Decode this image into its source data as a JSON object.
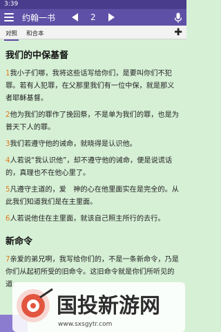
{
  "status": {
    "time": "3:39"
  },
  "header": {
    "title": "约翰一书",
    "chapter": "2"
  },
  "tabs": [
    "对照",
    "和合本"
  ],
  "content": {
    "heading1": "我们的中保基督",
    "verses1": [
      {
        "num": "1",
        "text": "我小子们哪，我将这些话写给你们，是要叫你们不犯罪。若有人犯罪，在父那里我们有一位中保，就是那义者耶稣基督。"
      },
      {
        "num": "2",
        "text": "他为我们的罪作了挽回祭，不是单为我们的罪，也是为普天下人的罪。"
      },
      {
        "num": "3",
        "text": "我们若遵守他的诫命，就晓得是认识他。"
      },
      {
        "num": "4",
        "text": "人若说“我认识他”，却不遵守他的诫命，便是说谎话的，真理也不在他心里了。"
      },
      {
        "num": "5",
        "text": "凡遵守主道的，爱　神的心在他里面实在是完全的。从此我们知道我们是在主里面。"
      },
      {
        "num": "6",
        "text": "人若说他住在主里面，就该自己照主所行的去行。"
      }
    ],
    "heading2": "新命令",
    "verses2": [
      {
        "num": "7",
        "text": "亲爱的弟兄啊，我写给你们的，不是一条新命令，乃是你们从起初所受的旧命令。这旧命令就是你们所听见的道。"
      }
    ]
  },
  "watermark": {
    "text": "国投新游网",
    "url": "www.sxsgytr.com"
  },
  "colors": {
    "appbar": "#5e50a6",
    "statusbar": "#4a3c8c",
    "background": "#d6f0d6",
    "verse_number": "#e07a1c"
  }
}
